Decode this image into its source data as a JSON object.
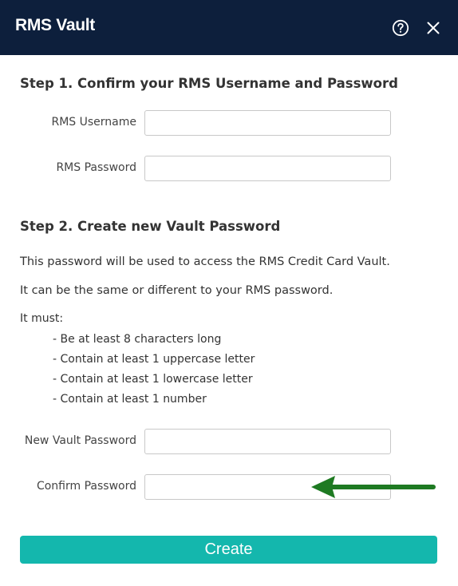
{
  "header": {
    "title": "RMS Vault",
    "help_icon": "question-circle-icon",
    "close_icon": "close-icon",
    "background": "#0d1f3c"
  },
  "step1": {
    "heading": "Step 1. Confirm your RMS Username and Password",
    "username_label": "RMS Username",
    "username_value": "",
    "password_label": "RMS Password",
    "password_value": ""
  },
  "step2": {
    "heading": "Step 2. Create new Vault Password",
    "description_1": "This password will be used to access the RMS Credit Card Vault.",
    "description_2": "It can be the same or different to your RMS password.",
    "requirements_title": "It must:",
    "requirements": [
      "- Be at least 8 characters long",
      "- Contain at least 1 uppercase letter",
      "- Contain at least 1 lowercase letter",
      "- Contain at least 1 number"
    ],
    "new_password_label": "New Vault Password",
    "new_password_value": "",
    "confirm_password_label": "Confirm Password",
    "confirm_password_value": ""
  },
  "actions": {
    "create_label": "Create",
    "create_color": "#14b7ad"
  },
  "annotation": {
    "arrow_color": "#1e7a22"
  }
}
